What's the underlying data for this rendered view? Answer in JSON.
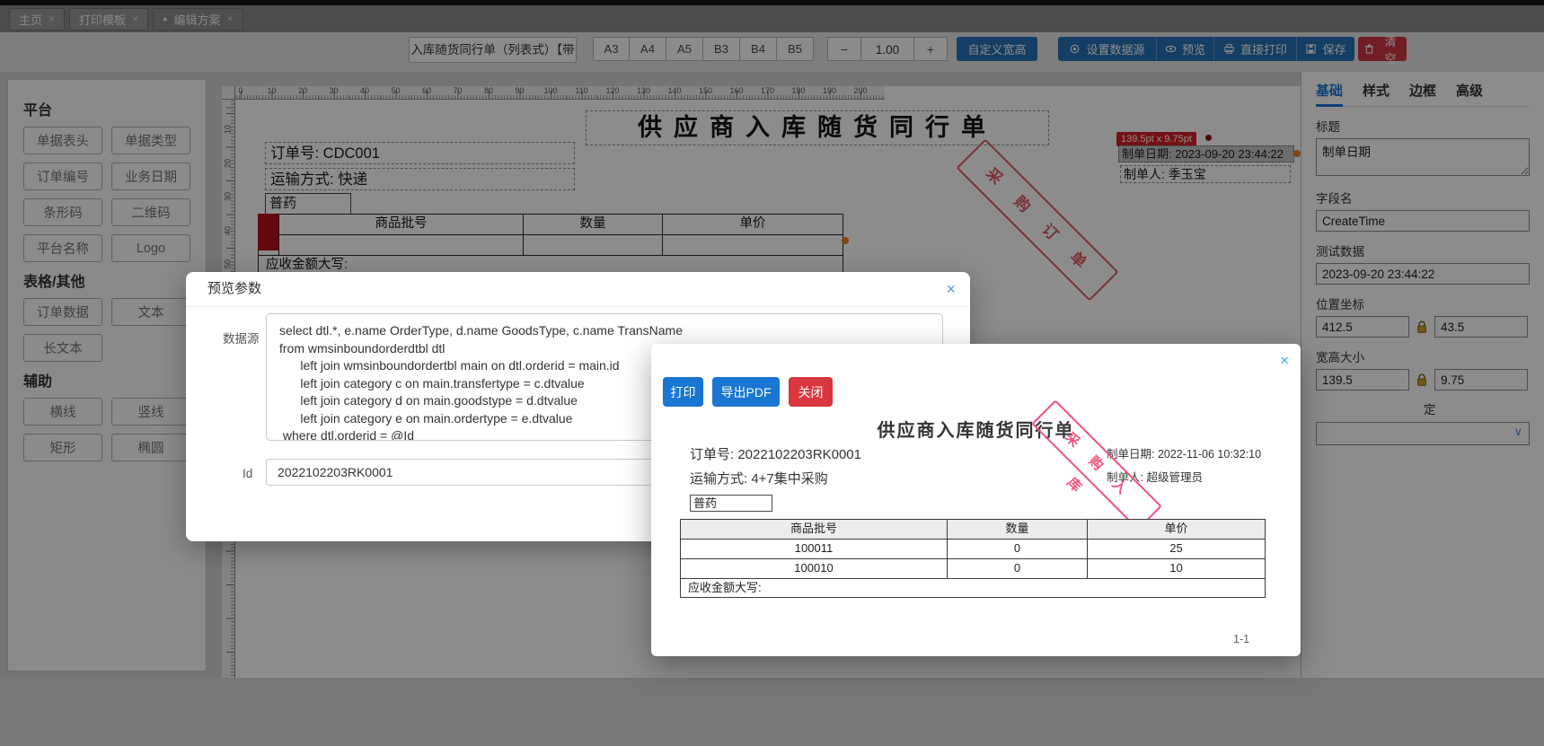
{
  "icons": {
    "close": "×",
    "dot": "●",
    "chevron_down": "∨",
    "names": [
      "gear-icon",
      "eye-icon",
      "printer-icon",
      "floppy-icon",
      "trash-icon",
      "lock-icon",
      "chevron-down-icon",
      "close-icon"
    ]
  },
  "colors": {
    "toolbar_primary": "#2672b4",
    "toolbar_danger": "#d03540",
    "modal_primary": "#1976d2",
    "modal_danger": "#d9363e",
    "active_tab_accent": "#1976d2",
    "tooltip_bg": "#d61f26",
    "table_red_marker": "#b5121b",
    "stamp_canvas": "#de5960",
    "stamp_preview": "#f2537a",
    "handle_orange": "#e0841f",
    "selection_bg": "#c7c7c7"
  },
  "tabs": [
    {
      "label": "主页",
      "active": false
    },
    {
      "label": "打印模板",
      "active": false
    },
    {
      "label": "编辑方案",
      "active": true
    }
  ],
  "toolbar": {
    "template_name": "入库随货同行单（列表式）【带",
    "paper_sizes": [
      "A3",
      "A4",
      "A5",
      "B3",
      "B4",
      "B5"
    ],
    "zoom": {
      "minus": "−",
      "value": "1.00",
      "plus": "+"
    },
    "custom_size_label": "自定义宽高",
    "set_datasource_label": "设置数据源",
    "preview_label": "预览",
    "direct_print_label": "直接打印",
    "save_label": "保存",
    "clear_label": "清空"
  },
  "sidebar": {
    "sections": [
      {
        "title": "平台",
        "items": [
          "单据表头",
          "单据类型",
          "订单编号",
          "业务日期",
          "条形码",
          "二维码",
          "平台名称",
          "Logo"
        ]
      },
      {
        "title": "表格/其他",
        "items": [
          "订单数据",
          "文本",
          "长文本"
        ]
      },
      {
        "title": "辅助",
        "items": [
          "横线",
          "竖线",
          "矩形",
          "椭圆"
        ]
      }
    ]
  },
  "canvas": {
    "ruler_h": [
      "0",
      "10",
      "20",
      "30",
      "40",
      "50",
      "60",
      "70",
      "80",
      "90",
      "100",
      "110",
      "120",
      "130",
      "140",
      "150",
      "160",
      "170",
      "180",
      "190",
      "200"
    ],
    "ruler_v": [
      "10",
      "20",
      "30",
      "40",
      "50"
    ],
    "size_tooltip": "139.5pt x 9.75pt",
    "doc": {
      "title": "供应商入库随货同行单",
      "order_no": "订单号: CDC001",
      "transport": "运输方式: 快递",
      "drug_type": "普药",
      "create_date": "制单日期: 2023-09-20 23:44:22",
      "creator": "制单人: 季玉宝",
      "stamp": "采购订单",
      "table": {
        "headers": [
          "商品批号",
          "数量",
          "单价"
        ],
        "footer": "应收金额大写:"
      }
    }
  },
  "properties": {
    "tabs": [
      "基础",
      "样式",
      "边框",
      "高级"
    ],
    "title_label": "标题",
    "title_value": "制单日期",
    "field_label": "字段名",
    "field_value": "CreateTime",
    "test_label": "测试数据",
    "test_value": "2023-09-20 23:44:22",
    "pos_label": "位置坐标",
    "pos_x": "412.5",
    "pos_y": "43.5",
    "size_label": "宽高大小",
    "size_w": "139.5",
    "size_h": "9.75",
    "partial_label": "定"
  },
  "preview_params_modal": {
    "title": "预览参数",
    "datasource_label": "数据源",
    "sql": "select dtl.*, e.name OrderType, d.name GoodsType, c.name TransName\nfrom wmsinboundorderdtbl dtl\n      left join wmsinboundordertbl main on dtl.orderid = main.id\n      left join category c on main.transfertype = c.dtvalue\n      left join category d on main.goodstype = d.dtvalue\n      left join category e on main.ordertype = e.dtvalue\n where dtl.orderid = @Id",
    "id_label": "Id",
    "id_value": "2022102203RK0001"
  },
  "preview_modal": {
    "print_label": "打印",
    "export_pdf_label": "导出PDF",
    "close_label": "关闭",
    "doc": {
      "title": "供应商入库随货同行单",
      "order_no": "订单号: 2022102203RK0001",
      "transport": "运输方式: 4+7集中采购",
      "create_date": "制单日期: 2022-11-06 10:32:10",
      "creator": "制单人: 超级管理员",
      "drug_type": "普药",
      "stamp": "采购入库",
      "table": {
        "headers": [
          "商品批号",
          "数量",
          "单价"
        ],
        "rows": [
          [
            "100011",
            "0",
            "25"
          ],
          [
            "100010",
            "0",
            "10"
          ]
        ],
        "footer": "应收金额大写:"
      },
      "page_indicator": "1-1"
    }
  }
}
